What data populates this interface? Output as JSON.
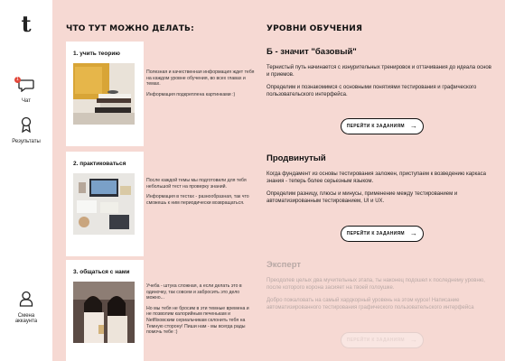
{
  "logo": "t",
  "sidebar": {
    "chat": {
      "label": "Чат",
      "badge": "1"
    },
    "results": {
      "label": "Результаты"
    },
    "account": {
      "label": "Смена аккаунта"
    }
  },
  "activities": {
    "title": "ЧТО ТУТ МОЖНО ДЕЛАТЬ:",
    "items": [
      {
        "title": "1. учить теорию",
        "text": [
          "Полезная и качественная информация ждет тебя на каждом уровне обучения, во всех главах и темах.",
          "Информация подкреплена картинками :)"
        ]
      },
      {
        "title": "2. практиковаться",
        "text": [
          "После каждой темы мы подготовили для тебя небольшой тест на проверку знаний.",
          "Информация в тестах - разнообразная, так что сможешь к ним периодически возвращаться."
        ]
      },
      {
        "title": "3. общаться с нами",
        "text": [
          "Учеба - штука сложная, а если делать это в одиночку, так совсем и забросить это дело можно...",
          "Но мы тебя не бросим в эти темные времена и не позволим калорийным печенькам и Netflixовским сериальчикам склонить тебя на Темную сторону! Пиши нам - мы всегда рады помочь тебе :)"
        ]
      }
    ]
  },
  "levels": {
    "title": "УРОВНИ ОБУЧЕНИЯ",
    "items": [
      {
        "title": "Б - значит \"базовый\"",
        "text": [
          "Тернистый путь начинается с изнурительных тренировок и оттачивания до идеала основ и приемов.",
          "Определим и познакомимся с основными понятиями тестирования и графического пользовательского интерфейса."
        ],
        "button": "ПЕРЕЙТИ К ЗАДАНИЯМ",
        "enabled": true
      },
      {
        "title": "Продвинутый",
        "text": [
          "Когда фундамент из основы тестирования заложен, приступаем к возведению каркаса знания - теперь более серьезным языком.",
          "Определим разницу, плюсы и минусы, применение между тестированием и автоматизированным тестированием, UI и UX."
        ],
        "button": "ПЕРЕЙТИ К ЗАДАНИЯМ",
        "enabled": true
      },
      {
        "title": "Эксперт",
        "text": [
          "Преодолев целых два мучительных этапа, ты наконец подошел к последнему уровню, после которого корона засияет на твоей голоушке.",
          "Добро пожаловать на самый хардкорный уровень на этом курсе! Написание автоматизированного тестирования графического пользовательского интерфейса"
        ],
        "button": "ПЕРЕЙТИ К ЗАДАНИЯМ",
        "enabled": false
      }
    ]
  },
  "icons": {
    "chat": "chat-bubble-icon",
    "results": "award-ribbon-icon",
    "account": "user-icon",
    "arrow": "arrow-right-icon"
  },
  "colors": {
    "background": "#f6d9d3",
    "badge": "#e2473a",
    "disabled_text": "#b8a8a5"
  }
}
